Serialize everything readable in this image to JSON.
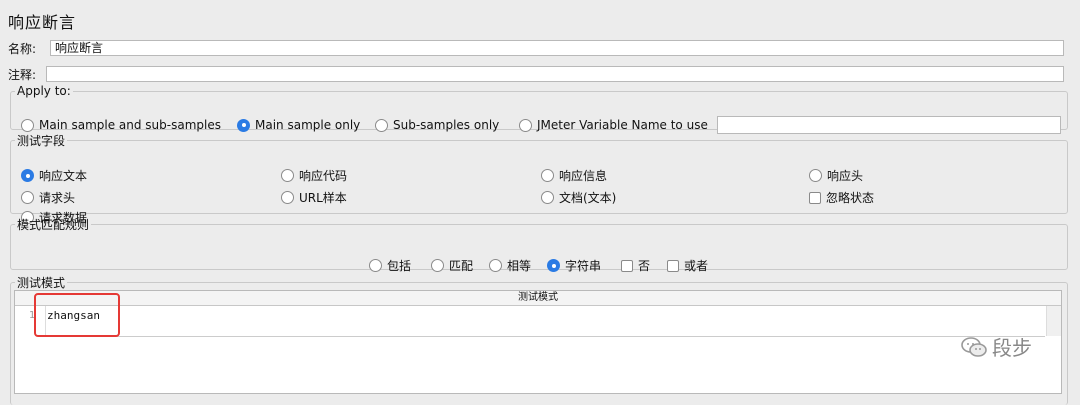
{
  "title": "响应断言",
  "name_label": "名称:",
  "name_value": "响应断言",
  "comment_label": "注释:",
  "comment_value": "",
  "apply": {
    "legend": "Apply to:",
    "options": [
      "Main sample and sub-samples",
      "Main sample only",
      "Sub-samples only",
      "JMeter Variable Name to use"
    ],
    "selected": "Main sample only",
    "var_value": ""
  },
  "field": {
    "legend": "测试字段",
    "options": [
      "响应文本",
      "响应代码",
      "响应信息",
      "响应头",
      "请求头",
      "URL样本",
      "文档(文本)",
      "忽略状态",
      "请求数据"
    ],
    "selected": "响应文本"
  },
  "match": {
    "legend": "模式匹配规则",
    "options": [
      "包括",
      "匹配",
      "相等",
      "字符串",
      "否",
      "或者"
    ],
    "selected": "字符串"
  },
  "patterns": {
    "legend": "测试模式",
    "column": "测试模式",
    "line_no": "1",
    "value": "zhangsan"
  },
  "watermark": "段步",
  "colors": {
    "accent": "#2b7be4",
    "highlight": "#e53935"
  }
}
